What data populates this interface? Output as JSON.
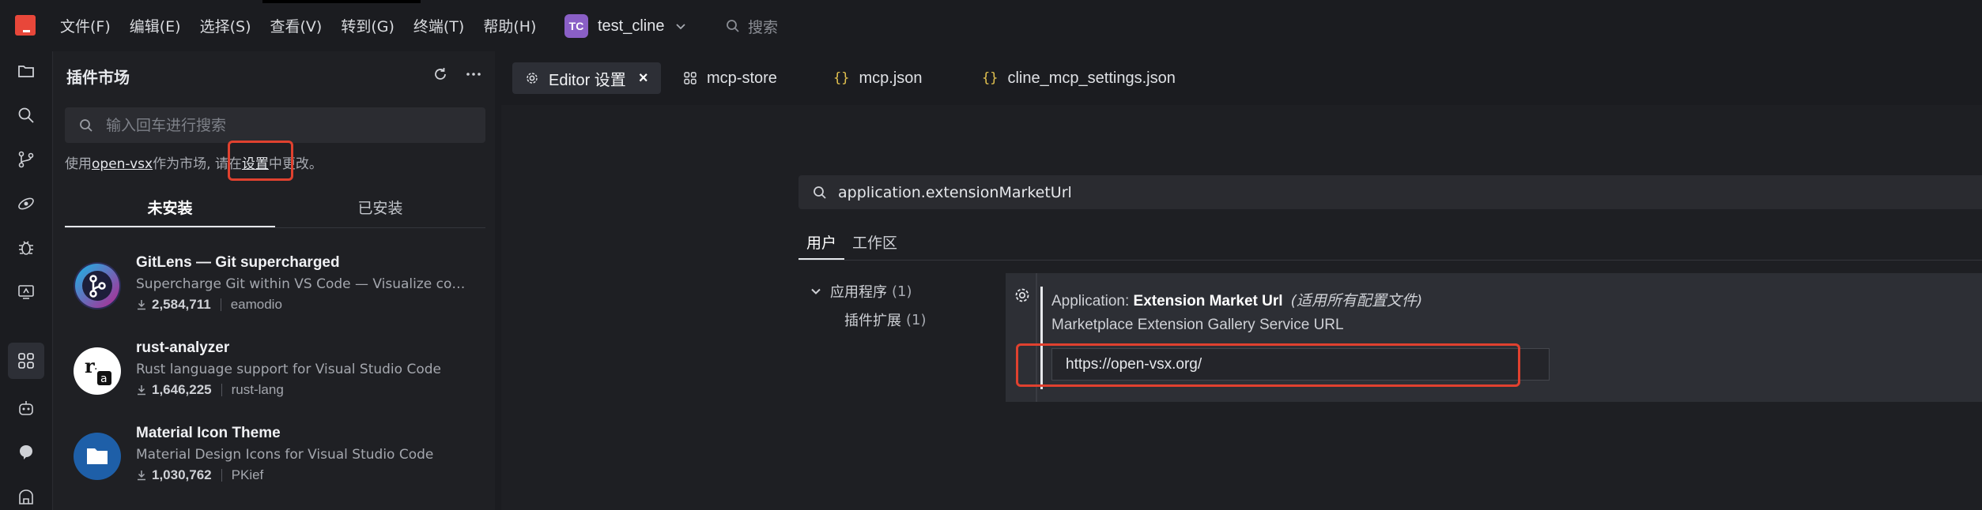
{
  "menu": {
    "items": [
      "文件(F)",
      "编辑(E)",
      "选择(S)",
      "查看(V)",
      "转到(G)",
      "终端(T)",
      "帮助(H)"
    ]
  },
  "project": {
    "badge": "TC",
    "name": "test_cline"
  },
  "top_search": {
    "placeholder": "搜索"
  },
  "activity_bar": {
    "icons": [
      "explorer-icon",
      "search-icon",
      "source-control-icon",
      "remote-icon",
      "debug-icon",
      "remote-explorer-icon",
      "extensions-icon",
      "robot-icon",
      "chat-icon",
      "marketplace-icon"
    ],
    "active": "extensions-icon"
  },
  "sidebar": {
    "title": "插件市场",
    "search_placeholder": "输入回车进行搜索",
    "note": {
      "prefix": "使用",
      "link": "open-vsx",
      "middle": "作为市场, 请在",
      "settings_link": "设置",
      "suffix": "中更改。"
    },
    "tabs": [
      "未安装",
      "已安装"
    ],
    "active_tab": "未安装",
    "extensions": [
      {
        "name": "GitLens — Git supercharged",
        "description": "Supercharge Git within VS Code — Visualize cod...",
        "downloads": "2,584,711",
        "publisher": "eamodio"
      },
      {
        "name": "rust-analyzer",
        "description": "Rust language support for Visual Studio Code",
        "downloads": "1,646,225",
        "publisher": "rust-lang"
      },
      {
        "name": "Material Icon Theme",
        "description": "Material Design Icons for Visual Studio Code",
        "downloads": "1,030,762",
        "publisher": "PKief"
      }
    ]
  },
  "editor": {
    "tabs": [
      {
        "label": "Editor 设置",
        "icon": "gear-icon",
        "active": true
      },
      {
        "label": "mcp-store",
        "icon": "grid-icon",
        "active": false
      },
      {
        "label": "mcp.json",
        "icon": "json-icon",
        "active": false
      },
      {
        "label": "cline_mcp_settings.json",
        "icon": "json-icon",
        "active": false
      }
    ],
    "settings": {
      "search_value": "application.extensionMarketUrl",
      "scope_tabs": [
        "用户",
        "工作区"
      ],
      "active_scope": "用户",
      "toc": [
        {
          "label": "应用程序",
          "count": "(1)"
        },
        {
          "label": "插件扩展",
          "count": "(1)"
        }
      ],
      "setting": {
        "title_prefix": "Application: ",
        "title_bold": "Extension Market Url",
        "title_scope": "(适用所有配置文件)",
        "description": "Marketplace Extension Gallery Service URL",
        "value": "https://open-vsx.org/"
      }
    }
  },
  "colors": {
    "highlight": "#e0412f",
    "logo": "#e8473a",
    "project_badge": "#8a5fc6",
    "json_brace": "#e2c14f"
  }
}
